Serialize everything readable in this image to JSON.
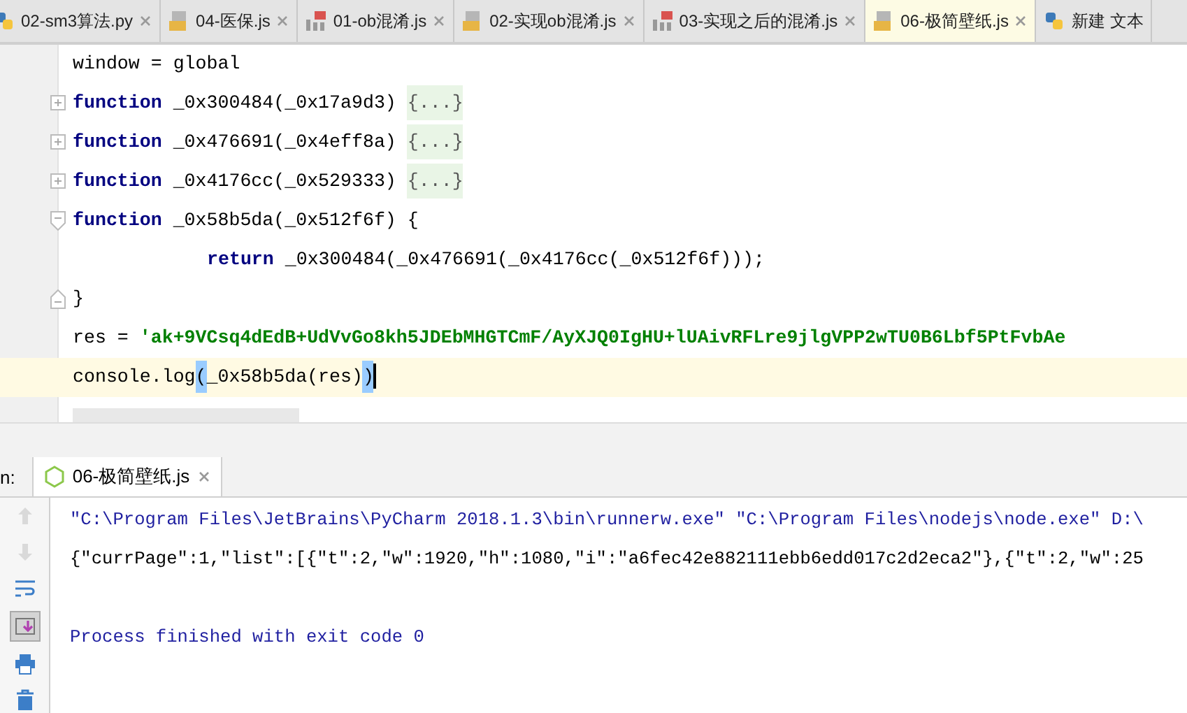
{
  "editor_tabs": [
    {
      "label": "02-sm3算法.py",
      "kind": "py",
      "selected": false
    },
    {
      "label": "04-医保.js",
      "kind": "js",
      "selected": false
    },
    {
      "label": "01-ob混淆.js",
      "kind": "jsbin",
      "selected": false
    },
    {
      "label": "02-实现ob混淆.js",
      "kind": "js",
      "selected": false
    },
    {
      "label": "03-实现之后的混淆.js",
      "kind": "jsbin",
      "selected": false
    },
    {
      "label": "06-极简壁纸.js",
      "kind": "js",
      "selected": true
    },
    {
      "label": "新建 文本",
      "kind": "txt",
      "selected": false
    }
  ],
  "code_lines": [
    {
      "kind": "plain",
      "current": false,
      "tokens": [
        {
          "kind": "plain",
          "text": "window = global"
        }
      ]
    },
    {
      "kind": "fold-collapsed",
      "current": false,
      "tokens": [
        {
          "kind": "keyword",
          "text": "function"
        },
        {
          "kind": "plain",
          "text": " _0x300484(_0x17a9d3) "
        },
        {
          "kind": "folded",
          "text": "{...}"
        }
      ]
    },
    {
      "kind": "fold-collapsed",
      "current": false,
      "tokens": [
        {
          "kind": "keyword",
          "text": "function"
        },
        {
          "kind": "plain",
          "text": " _0x476691(_0x4eff8a) "
        },
        {
          "kind": "folded",
          "text": "{...}"
        }
      ]
    },
    {
      "kind": "fold-collapsed",
      "current": false,
      "tokens": [
        {
          "kind": "keyword",
          "text": "function"
        },
        {
          "kind": "plain",
          "text": " _0x4176cc(_0x529333) "
        },
        {
          "kind": "folded",
          "text": "{...}"
        }
      ]
    },
    {
      "kind": "fold-open",
      "current": false,
      "tokens": [
        {
          "kind": "keyword",
          "text": "function"
        },
        {
          "kind": "plain",
          "text": " _0x58b5da(_0x512f6f) {"
        }
      ]
    },
    {
      "kind": "indented",
      "current": false,
      "tokens": [
        {
          "kind": "keyword",
          "text": "return"
        },
        {
          "kind": "plain",
          "text": " _0x300484(_0x476691(_0x4176cc(_0x512f6f)));"
        }
      ]
    },
    {
      "kind": "fold-close",
      "current": false,
      "tokens": [
        {
          "kind": "plain",
          "text": "}"
        }
      ]
    },
    {
      "kind": "plain",
      "current": false,
      "tokens": [
        {
          "kind": "plain",
          "text": "res = "
        },
        {
          "kind": "string",
          "text": "'ak+9VCsq4dEdB+UdVvGo8kh5JDEbMHGTCmF/AyXJQ0IgHU+lUAivRFLre9jlgVPP2wTU0B6Lbf5PtFvbAe"
        }
      ]
    },
    {
      "kind": "plain",
      "current": true,
      "tokens": [
        {
          "kind": "plain",
          "text": "console.log"
        },
        {
          "kind": "match",
          "text": "("
        },
        {
          "kind": "plain",
          "text": "_0x58b5da(res)"
        },
        {
          "kind": "match",
          "text": ")"
        }
      ]
    }
  ],
  "run_panel": {
    "label": "n:",
    "tab": {
      "label": "06-极简壁纸.js",
      "selected": true
    },
    "toolbar": [
      {
        "kind": "up",
        "disabled": true,
        "selected": false
      },
      {
        "kind": "down",
        "disabled": true,
        "selected": false
      },
      {
        "kind": "wrap",
        "disabled": false,
        "selected": false
      },
      {
        "kind": "scroll-end",
        "disabled": false,
        "selected": true
      },
      {
        "kind": "print",
        "disabled": false,
        "selected": false
      },
      {
        "kind": "trash",
        "disabled": false,
        "selected": false
      }
    ],
    "console_lines": [
      {
        "kind": "command",
        "text": "\"C:\\Program Files\\JetBrains\\PyCharm 2018.1.3\\bin\\runnerw.exe\" \"C:\\Program Files\\nodejs\\node.exe\" D:\\"
      },
      {
        "kind": "output",
        "text": "{\"currPage\":1,\"list\":[{\"t\":2,\"w\":1920,\"h\":1080,\"i\":\"a6fec42e882111ebb6edd017c2d2eca2\"},{\"t\":2,\"w\":25"
      },
      {
        "kind": "blank"
      },
      {
        "kind": "system",
        "text": "Process finished with exit code 0"
      }
    ]
  }
}
